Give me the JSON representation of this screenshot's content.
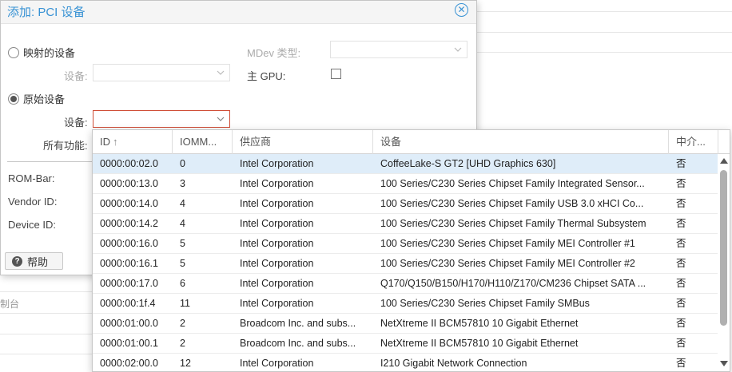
{
  "background": {
    "partial_label": "制台"
  },
  "dialog": {
    "title": "添加: PCI 设备",
    "close_icon": "close-circle-icon",
    "mapped_device_label": "映射的设备",
    "mapped_device_field_label": "设备:",
    "raw_device_label": "原始设备",
    "raw_device_field_label": "设备:",
    "all_functions_label": "所有功能:",
    "mdev_type_label": "MDev 类型:",
    "primary_gpu_label": "主 GPU:",
    "rom_bar_label": "ROM-Bar:",
    "vendor_id_label": "Vendor ID:",
    "device_id_label": "Device ID:",
    "help_label": "帮助",
    "raw_device_selected": true
  },
  "grid": {
    "columns": [
      "ID",
      "IOMM...",
      "供应商",
      "设备",
      "中介..."
    ],
    "sort_indicator": "↑",
    "rows": [
      {
        "id": "0000:00:02.0",
        "iommu": "0",
        "vendor": "Intel Corporation",
        "device": "CoffeeLake-S GT2 [UHD Graphics 630]",
        "mdev": "否"
      },
      {
        "id": "0000:00:13.0",
        "iommu": "3",
        "vendor": "Intel Corporation",
        "device": "100 Series/C230 Series Chipset Family Integrated Sensor...",
        "mdev": "否"
      },
      {
        "id": "0000:00:14.0",
        "iommu": "4",
        "vendor": "Intel Corporation",
        "device": "100 Series/C230 Series Chipset Family USB 3.0 xHCI Co...",
        "mdev": "否"
      },
      {
        "id": "0000:00:14.2",
        "iommu": "4",
        "vendor": "Intel Corporation",
        "device": "100 Series/C230 Series Chipset Family Thermal Subsystem",
        "mdev": "否"
      },
      {
        "id": "0000:00:16.0",
        "iommu": "5",
        "vendor": "Intel Corporation",
        "device": "100 Series/C230 Series Chipset Family MEI Controller #1",
        "mdev": "否"
      },
      {
        "id": "0000:00:16.1",
        "iommu": "5",
        "vendor": "Intel Corporation",
        "device": "100 Series/C230 Series Chipset Family MEI Controller #2",
        "mdev": "否"
      },
      {
        "id": "0000:00:17.0",
        "iommu": "6",
        "vendor": "Intel Corporation",
        "device": "Q170/Q150/B150/H170/H110/Z170/CM236 Chipset SATA ...",
        "mdev": "否"
      },
      {
        "id": "0000:00:1f.4",
        "iommu": "11",
        "vendor": "Intel Corporation",
        "device": "100 Series/C230 Series Chipset Family SMBus",
        "mdev": "否"
      },
      {
        "id": "0000:01:00.0",
        "iommu": "2",
        "vendor": "Broadcom Inc. and subs...",
        "device": "NetXtreme II BCM57810 10 Gigabit Ethernet",
        "mdev": "否"
      },
      {
        "id": "0000:01:00.1",
        "iommu": "2",
        "vendor": "Broadcom Inc. and subs...",
        "device": "NetXtreme II BCM57810 10 Gigabit Ethernet",
        "mdev": "否"
      },
      {
        "id": "0000:02:00.0",
        "iommu": "12",
        "vendor": "Intel Corporation",
        "device": "I210 Gigabit Network Connection",
        "mdev": "否"
      }
    ],
    "selected_index": 0
  },
  "colors": {
    "accent": "#3892d4",
    "selected_row": "#dfedf9",
    "invalid_border": "#cf4c35"
  }
}
